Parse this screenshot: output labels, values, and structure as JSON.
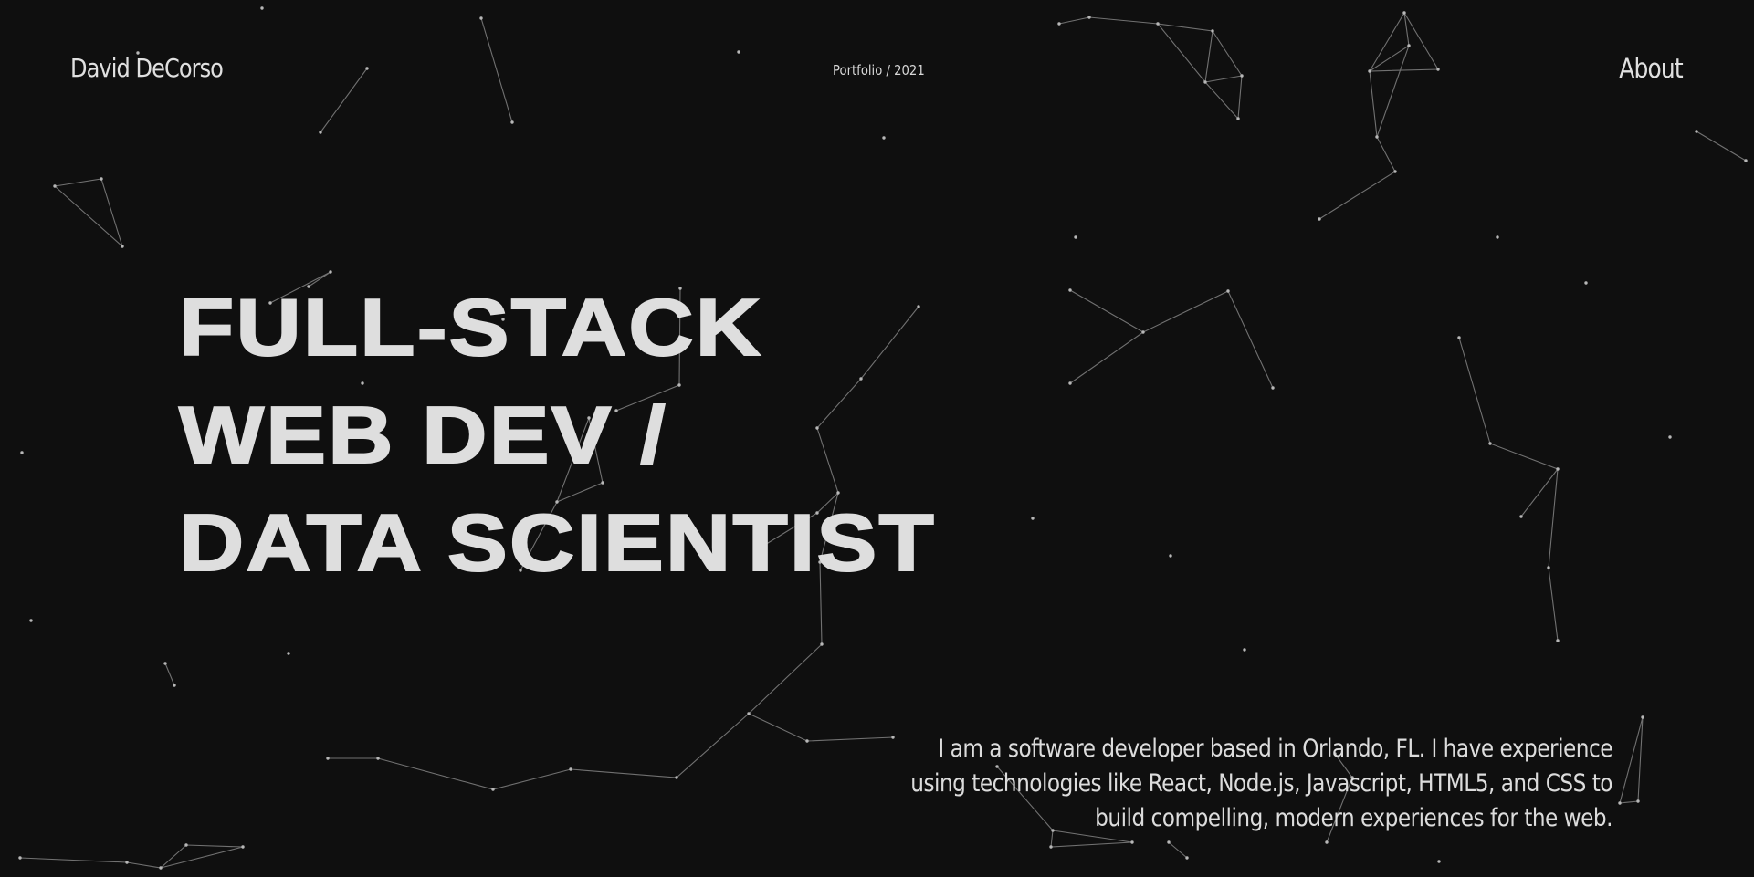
{
  "header": {
    "brand": "David DeCorso",
    "crumb": "Portfolio / 2021",
    "nav_about": "About"
  },
  "hero": {
    "lines": [
      "FULL-STACK",
      "WEB DEV /",
      "DATA SCIENTIST"
    ]
  },
  "bio": {
    "text": "I am a software developer based in Orlando, FL. I have experience using technologies like React, Node.js, Javascript, HTML5, and CSS to build compelling, modern experiences for the web."
  },
  "colors": {
    "background": "#0f0f0f",
    "text": "#e0e0e0",
    "network": "#9a9a9a"
  }
}
